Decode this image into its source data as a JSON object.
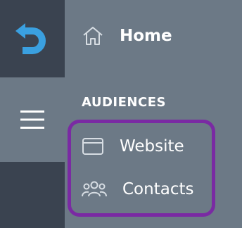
{
  "nav": {
    "logo_icon": "brand-arrow-logo-icon",
    "menu_icon": "hamburger-menu-icon",
    "home": {
      "label": "Home",
      "icon": "home-icon"
    },
    "section_heading": "AUDIENCES",
    "items": [
      {
        "label": "Website",
        "icon": "browser-window-icon"
      },
      {
        "label": "Contacts",
        "icon": "people-group-icon"
      }
    ]
  },
  "colors": {
    "rail": "#3a4350",
    "panel": "#6c7986",
    "accent_logo": "#3aa0e0",
    "highlight_border": "#7a2aa3",
    "text": "#ffffff"
  }
}
